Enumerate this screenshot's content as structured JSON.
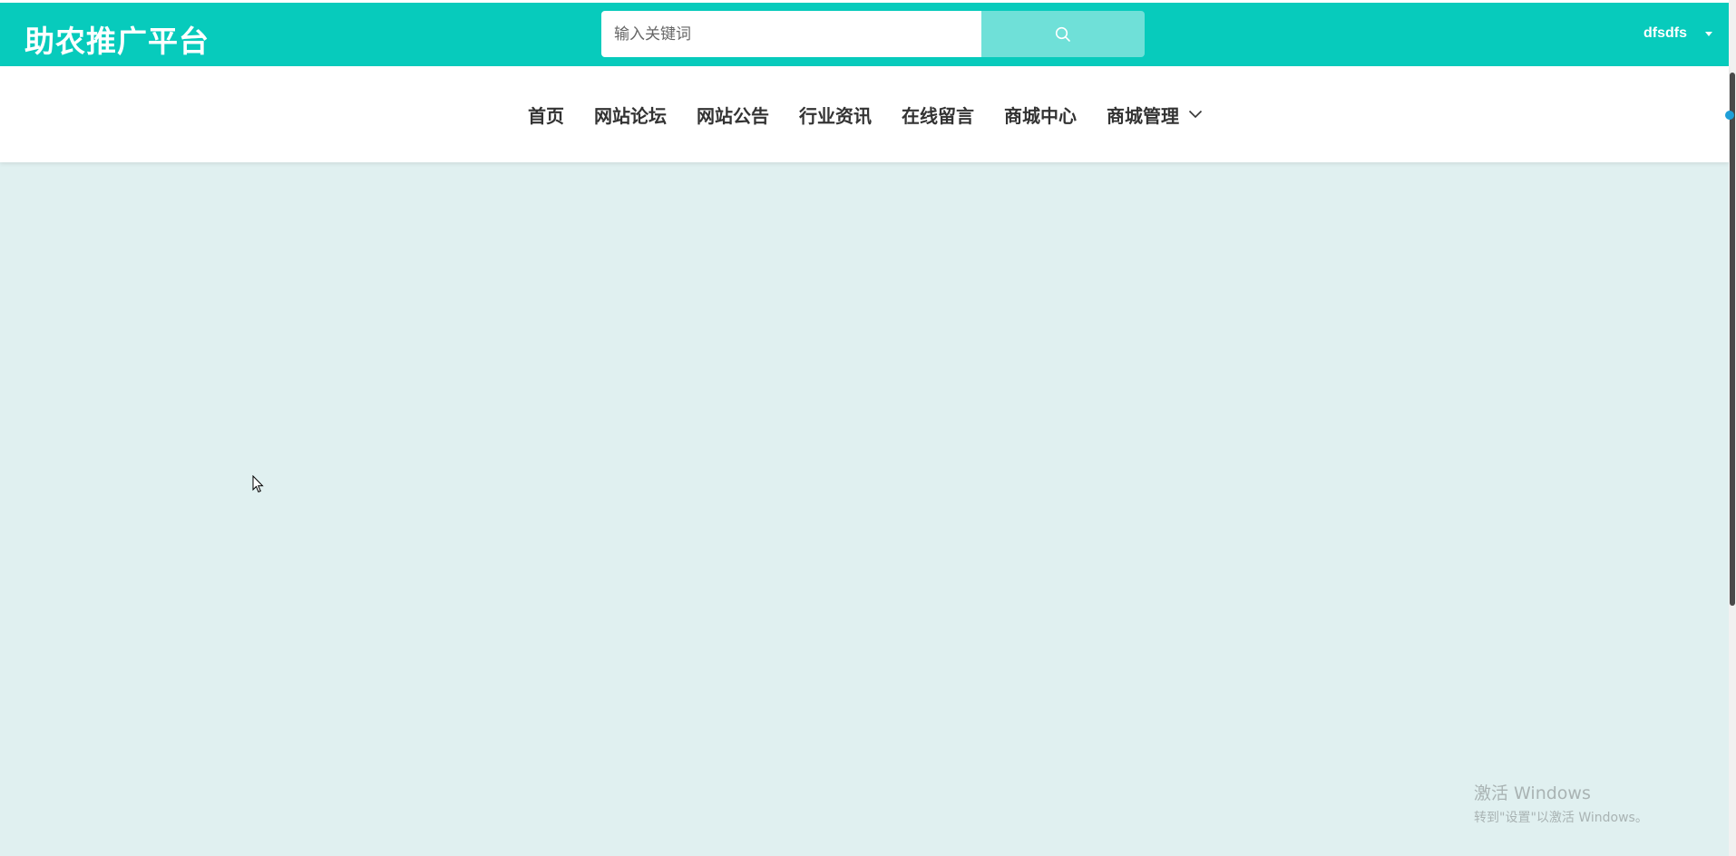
{
  "header": {
    "logo": "助农推广平台",
    "search": {
      "placeholder": "输入关键词",
      "value": "",
      "button_icon": "search-icon"
    },
    "user": {
      "name": "dfsdfs",
      "icon": "caret-down-icon"
    }
  },
  "nav": {
    "items": [
      {
        "label": "首页"
      },
      {
        "label": "网站论坛"
      },
      {
        "label": "网站公告"
      },
      {
        "label": "行业资讯"
      },
      {
        "label": "在线留言"
      },
      {
        "label": "商城中心"
      },
      {
        "label": "商城管理",
        "icon": "chevron-down-icon"
      }
    ]
  },
  "watermark": {
    "line1": "激活 Windows",
    "line2": "转到\"设置\"以激活 Windows。"
  },
  "colors": {
    "primary": "#07cbbc",
    "search_button": "#6fe0d8",
    "content_bg": "#e0f0f0",
    "nav_text": "#333333"
  }
}
